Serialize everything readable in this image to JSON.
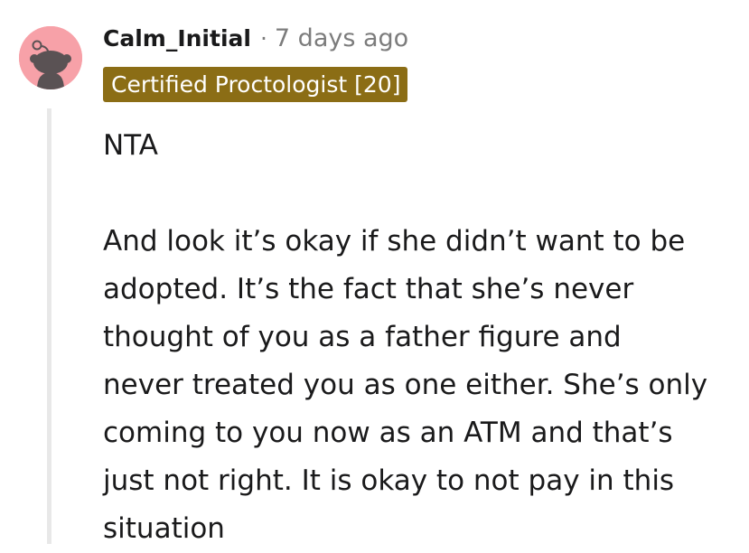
{
  "comment": {
    "username": "Calm_Initial",
    "separator": "·",
    "timestamp": "7 days ago",
    "flair": "Certified Proctologist [20]",
    "paragraphs": [
      [
        "NTA"
      ],
      [
        "And look it’s okay if she didn’t want to be",
        "adopted. It’s the fact that she’s never",
        "thought of you as a father figure and",
        "never treated you as one either. She’s only",
        "coming to you now as an ATM and that’s",
        "just not right. It is okay to not pay in this",
        "situation"
      ]
    ]
  },
  "colors": {
    "avatar_bg": "#f7a1a8",
    "flair_bg": "#8b6d15",
    "thread_line": "#e8e8e8",
    "meta_text": "#7c7c7c"
  },
  "icons": {
    "avatar": "snoo-avatar-icon"
  }
}
